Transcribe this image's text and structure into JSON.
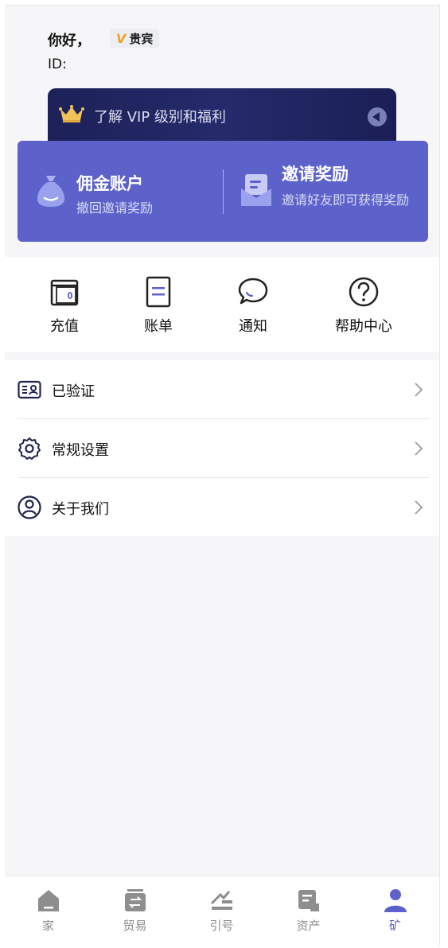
{
  "header": {
    "greeting": "你好，",
    "vip_badge": {
      "letter": "V",
      "label": "贵宾"
    },
    "id_label": "ID:"
  },
  "vip_banner": {
    "text": "了解 VIP 级别和福利"
  },
  "account_card": {
    "left": {
      "title": "佣金账户",
      "subtitle": "撤回邀请奖励",
      "icon": "money-bag-icon"
    },
    "right": {
      "title": "邀请奖励",
      "subtitle": "邀请好友即可获得奖励",
      "icon": "mail-icon"
    }
  },
  "quick_menu": [
    {
      "label": "充值",
      "icon": "wallet-icon"
    },
    {
      "label": "账单",
      "icon": "bill-icon"
    },
    {
      "label": "通知",
      "icon": "chat-bubble-icon"
    },
    {
      "label": "帮助中心",
      "icon": "help-icon"
    }
  ],
  "settings_list": [
    {
      "label": "已验证",
      "icon": "id-card-icon"
    },
    {
      "label": "常规设置",
      "icon": "gear-icon"
    },
    {
      "label": "关于我们",
      "icon": "user-circle-icon"
    }
  ],
  "tabbar": {
    "active_index": 4,
    "items": [
      {
        "label": "家",
        "icon": "home-icon"
      },
      {
        "label": "贸易",
        "icon": "trade-icon"
      },
      {
        "label": "引号",
        "icon": "quotes-icon"
      },
      {
        "label": "资产",
        "icon": "assets-icon"
      },
      {
        "label": "矿",
        "icon": "profile-icon"
      }
    ]
  },
  "colors": {
    "accent": "#5c62c9",
    "banner": "#1d2158",
    "vip_gold": "#f0a020"
  }
}
